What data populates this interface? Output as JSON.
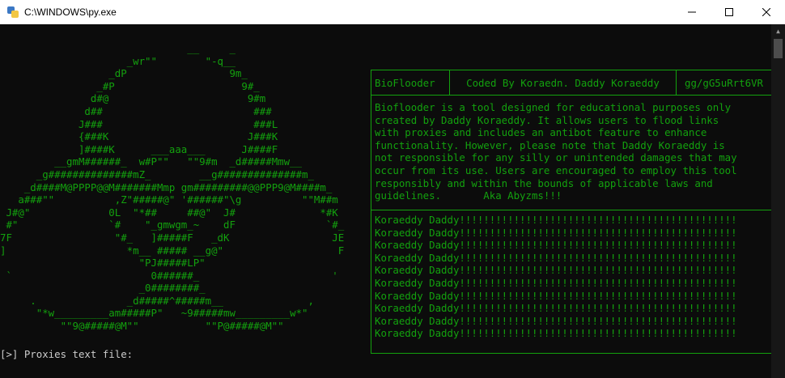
{
  "window": {
    "title": "C:\\WINDOWS\\py.exe",
    "icon": "python-launcher-icon",
    "controls": {
      "minimize": "minimize-icon",
      "maximize": "maximize-icon",
      "close": "close-icon"
    }
  },
  "colors": {
    "console_bg": "#0c0c0c",
    "green": "#13a10e",
    "prompt": "#cccccc"
  },
  "ascii_art": [
    "                               __     _",
    "                     _wr\"\"        \"-q__",
    "                  _dP                 9m_",
    "                _#P                     9#_",
    "               d#@                       9#m",
    "              d##                         ###",
    "             J###                         ###L",
    "             {###K                       J###K",
    "             ]####K      ___aaa___      J####F",
    "         __gmM######_  w#P\"\"   \"\"9#m  _d#####Mmw__",
    "      _g##############mZ_        __g##############m_",
    "    _d####M@PPPP@@M#######Mmp gm#########@@PPP9@M####m_",
    "   a###\"\"          ,Z\"#####@\" '######\"\\g          \"\"M##m",
    " J#@\"             0L  \"*##     ##@\"  J#              *#K",
    " #\"               `#    \"_gmwgm_~    dF               `#_",
    "7F                 \"#_   ]#####F   _dK                 JE",
    "]                    *m__ ##### __g@\"                   F",
    "                       \"PJ#####LP\"",
    " `                       0######_                      '",
    "                       _0########_",
    "     .               _d#####^#####m__              ,",
    "      \"*w_________am#####P\"   ~9#####mw_________w*\"",
    "          \"\"9@#####@M\"\"           \"\"P@#####@M\"\""
  ],
  "info": {
    "name": "BioFlooder",
    "credit": "Coded By Koraedn. Daddy Koraeddy",
    "link": "gg/gG5uRrt6VR",
    "description": "Bioflooder is a tool designed for educational purposes only\ncreated by Daddy Koraeddy. It allows users to flood links\nwith proxies and includes an antibot feature to enhance\nfunctionality. However, please note that Daddy Koraeddy is\nnot responsible for any silly or unintended damages that may\noccur from its use. Users are encouraged to employ this tool\nresponsibly and within the bounds of applicable laws and\nguidelines.       Aka Abyzms!!!",
    "lines": [
      "Koraeddy Daddy!!!!!!!!!!!!!!!!!!!!!!!!!!!!!!!!!!!!!!!!!!!!!!",
      "Koraeddy Daddy!!!!!!!!!!!!!!!!!!!!!!!!!!!!!!!!!!!!!!!!!!!!!!",
      "Koraeddy Daddy!!!!!!!!!!!!!!!!!!!!!!!!!!!!!!!!!!!!!!!!!!!!!!",
      "Koraeddy Daddy!!!!!!!!!!!!!!!!!!!!!!!!!!!!!!!!!!!!!!!!!!!!!!",
      "Koraeddy Daddy!!!!!!!!!!!!!!!!!!!!!!!!!!!!!!!!!!!!!!!!!!!!!!",
      "Koraeddy Daddy!!!!!!!!!!!!!!!!!!!!!!!!!!!!!!!!!!!!!!!!!!!!!!",
      "Koraeddy Daddy!!!!!!!!!!!!!!!!!!!!!!!!!!!!!!!!!!!!!!!!!!!!!!",
      "Koraeddy Daddy!!!!!!!!!!!!!!!!!!!!!!!!!!!!!!!!!!!!!!!!!!!!!!",
      "Koraeddy Daddy!!!!!!!!!!!!!!!!!!!!!!!!!!!!!!!!!!!!!!!!!!!!!!",
      "Koraeddy Daddy!!!!!!!!!!!!!!!!!!!!!!!!!!!!!!!!!!!!!!!!!!!!!!"
    ]
  },
  "prompt": "[>] Proxies text file: "
}
